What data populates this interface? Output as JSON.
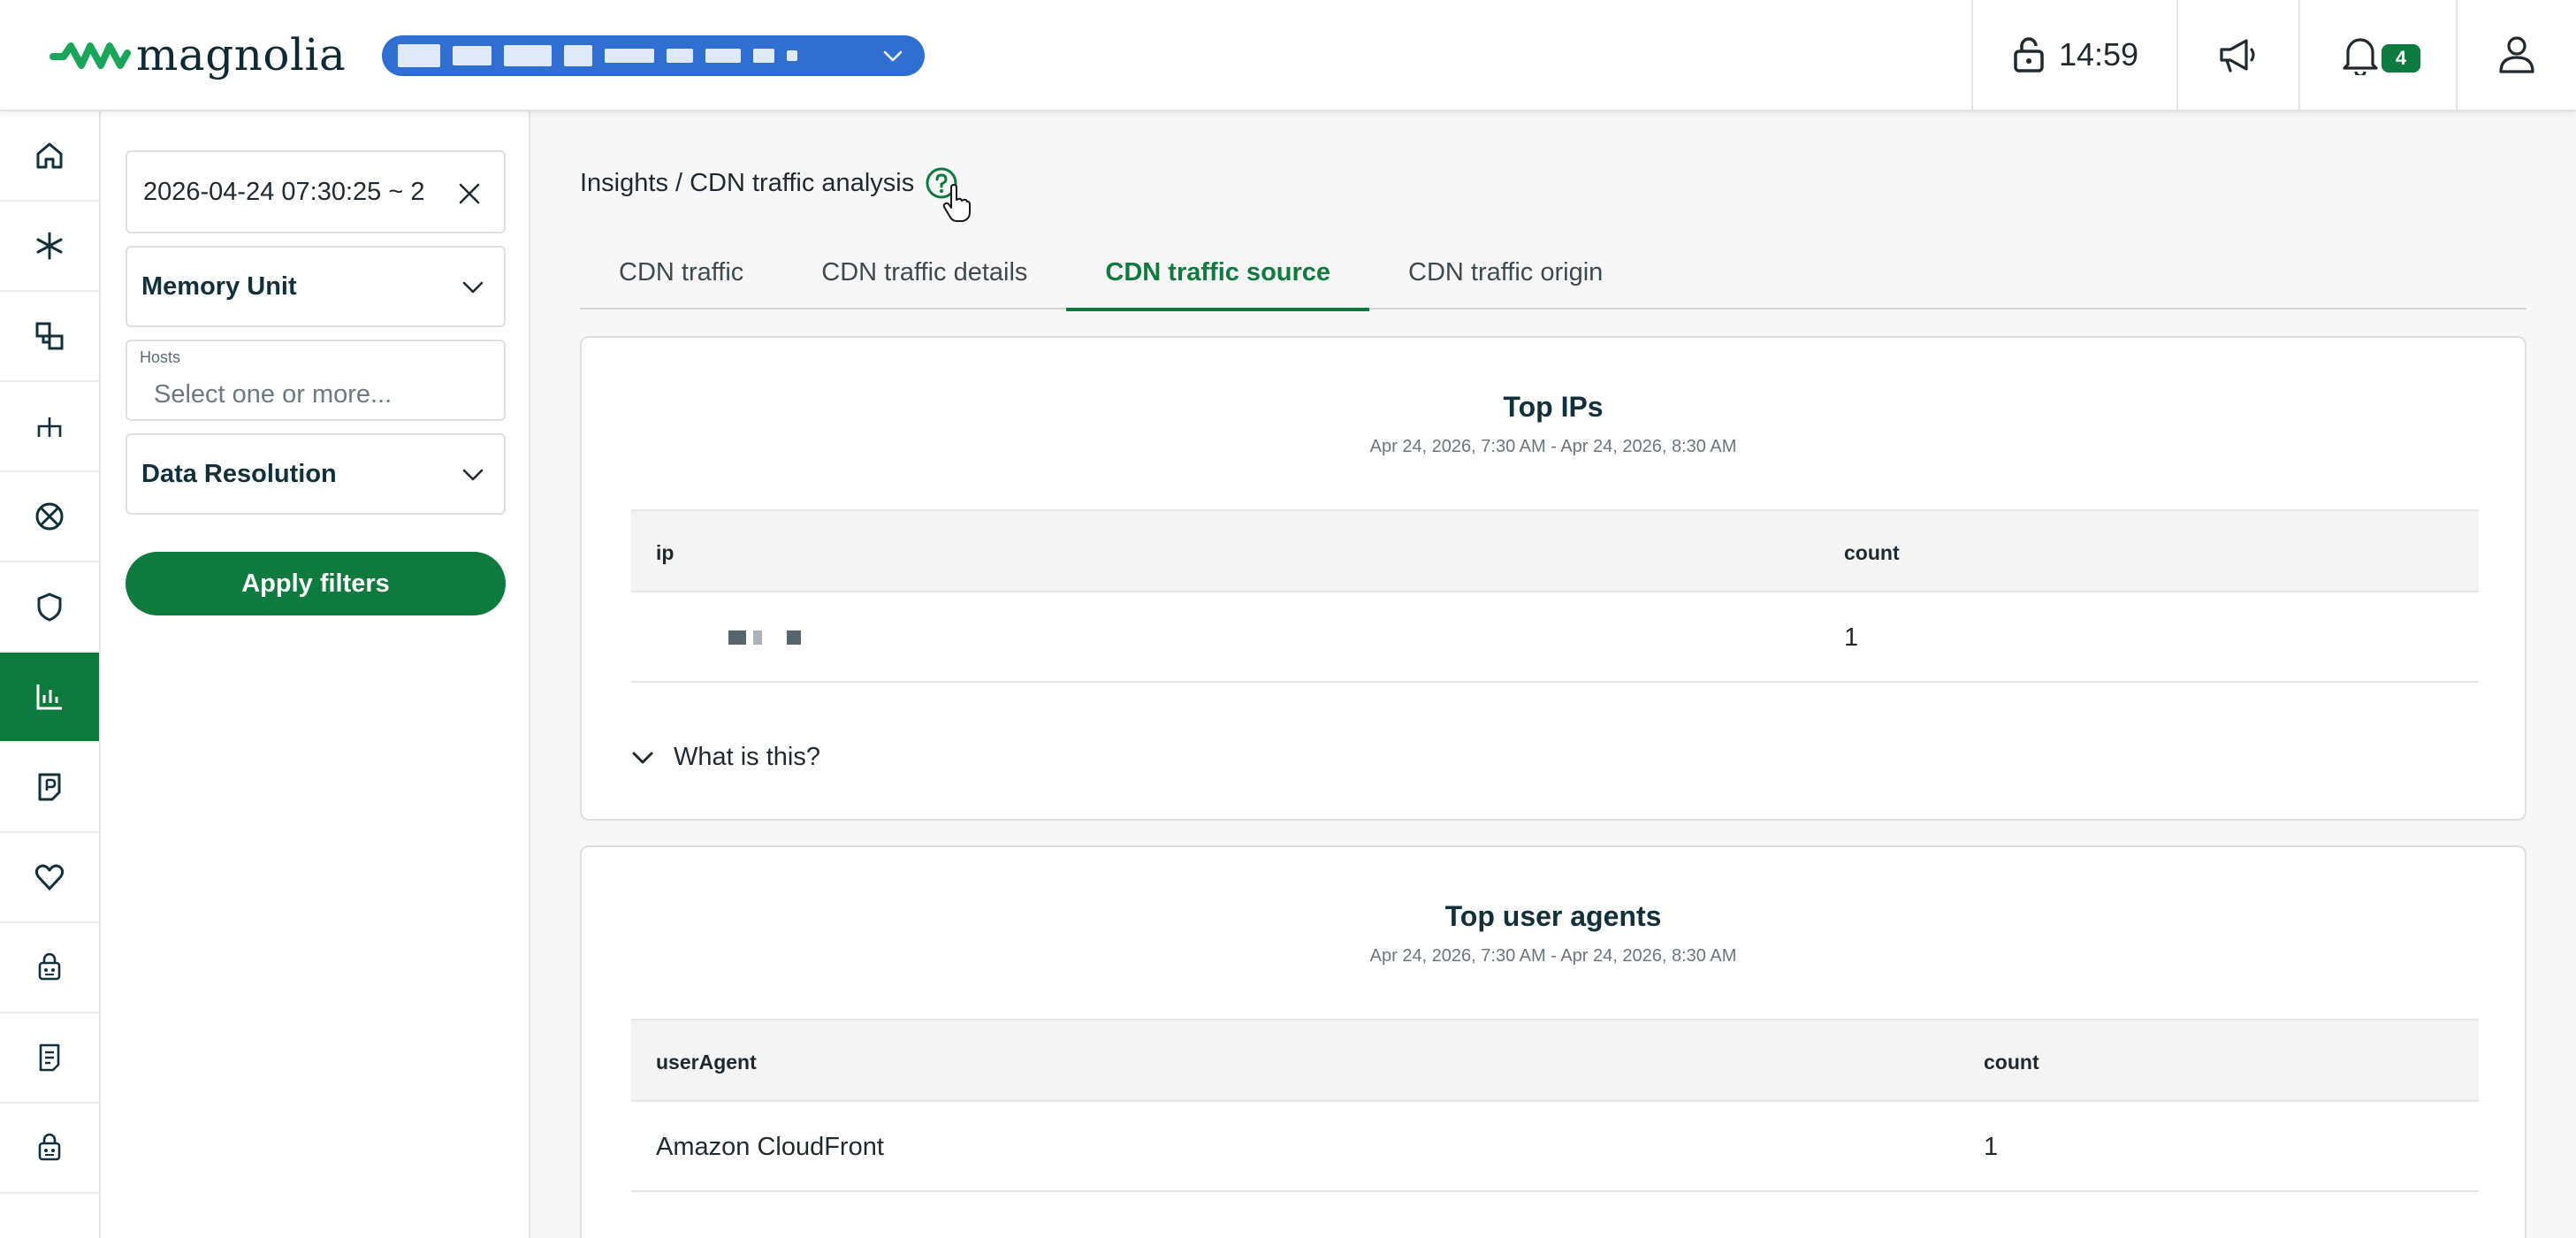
{
  "header": {
    "logo_text": "magnolia",
    "session_time": "14:59",
    "notification_count": "4",
    "brand_color": "#0e7a3e",
    "env_selector_color": "#2f6fd1"
  },
  "leftnav": {
    "items": [
      {
        "icon": "home-icon"
      },
      {
        "icon": "asterisk-icon"
      },
      {
        "icon": "environments-icon"
      },
      {
        "icon": "branch-icon"
      },
      {
        "icon": "globe-icon"
      },
      {
        "icon": "shield-icon"
      },
      {
        "icon": "chart-icon",
        "active": true
      },
      {
        "icon": "document-icon"
      },
      {
        "icon": "heart-icon"
      },
      {
        "icon": "robot-icon"
      },
      {
        "icon": "notes-icon"
      },
      {
        "icon": "robot-icon"
      }
    ]
  },
  "filters": {
    "date_range": "2026-04-24 07:30:25 ~ 2",
    "memory_unit_label": "Memory Unit",
    "hosts_label": "Hosts",
    "hosts_placeholder": "Select one or more...",
    "data_resolution_label": "Data Resolution",
    "apply_label": "Apply filters"
  },
  "main": {
    "breadcrumb": "Insights / CDN traffic analysis",
    "tabs": [
      {
        "label": "CDN traffic"
      },
      {
        "label": "CDN traffic details"
      },
      {
        "label": "CDN traffic source",
        "active": true
      },
      {
        "label": "CDN traffic origin"
      }
    ],
    "top_ips": {
      "title": "Top IPs",
      "subtitle": "Apr 24, 2026, 7:30 AM - Apr 24, 2026, 8:30 AM",
      "columns": [
        "ip",
        "count"
      ],
      "rows": [
        {
          "count": "1"
        }
      ],
      "expander_label": "What is this?"
    },
    "top_user_agents": {
      "title": "Top user agents",
      "subtitle": "Apr 24, 2026, 7:30 AM - Apr 24, 2026, 8:30 AM",
      "columns": [
        "userAgent",
        "count"
      ],
      "rows": [
        {
          "userAgent": "Amazon CloudFront",
          "count": "1"
        }
      ]
    }
  }
}
